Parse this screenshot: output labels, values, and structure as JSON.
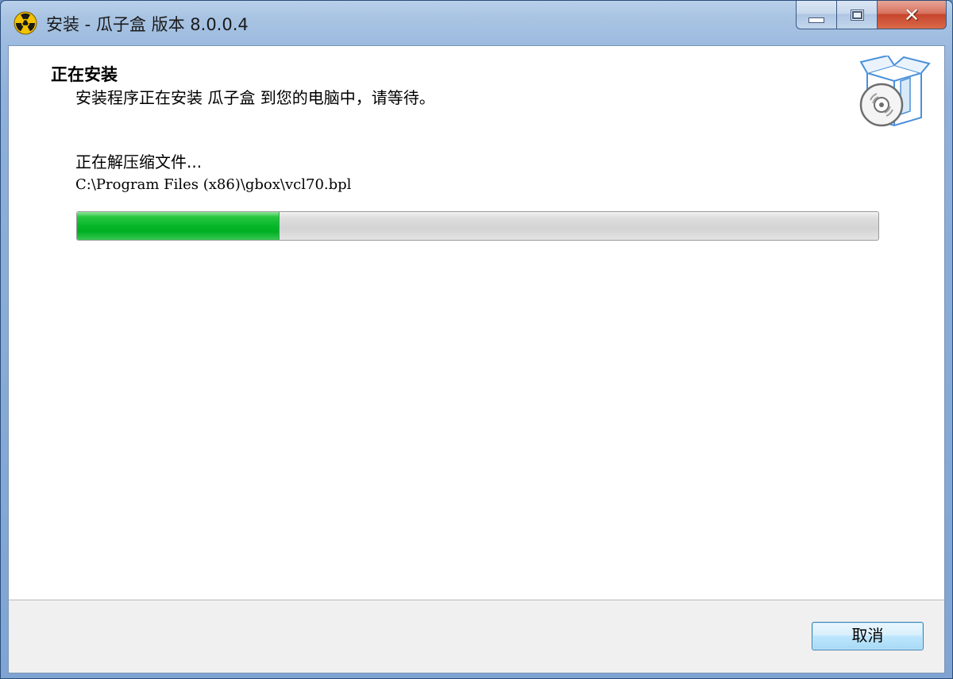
{
  "window": {
    "title": "安装 - 瓜子盒 版本 8.0.0.4",
    "icon": "radiation-app-icon",
    "caption_buttons": {
      "minimize": "minimize-icon",
      "maximize": "maximize-icon",
      "close": "close-icon"
    }
  },
  "header": {
    "title": "正在安装",
    "subtitle": "安装程序正在安装 瓜子盒 到您的电脑中，请等待。",
    "graphic": "installer-box-disc-icon"
  },
  "progress": {
    "status": "正在解压缩文件...",
    "current_file": "C:\\Program Files (x86)\\gbox\\vcl70.bpl",
    "fraction": 0.252
  },
  "footer": {
    "cancel_label": "取消"
  },
  "colors": {
    "progress_fill": "#06b72a",
    "title_bar": "#9dbbe0",
    "close_button": "#c7452c",
    "cancel_border": "#3c7fb1"
  }
}
